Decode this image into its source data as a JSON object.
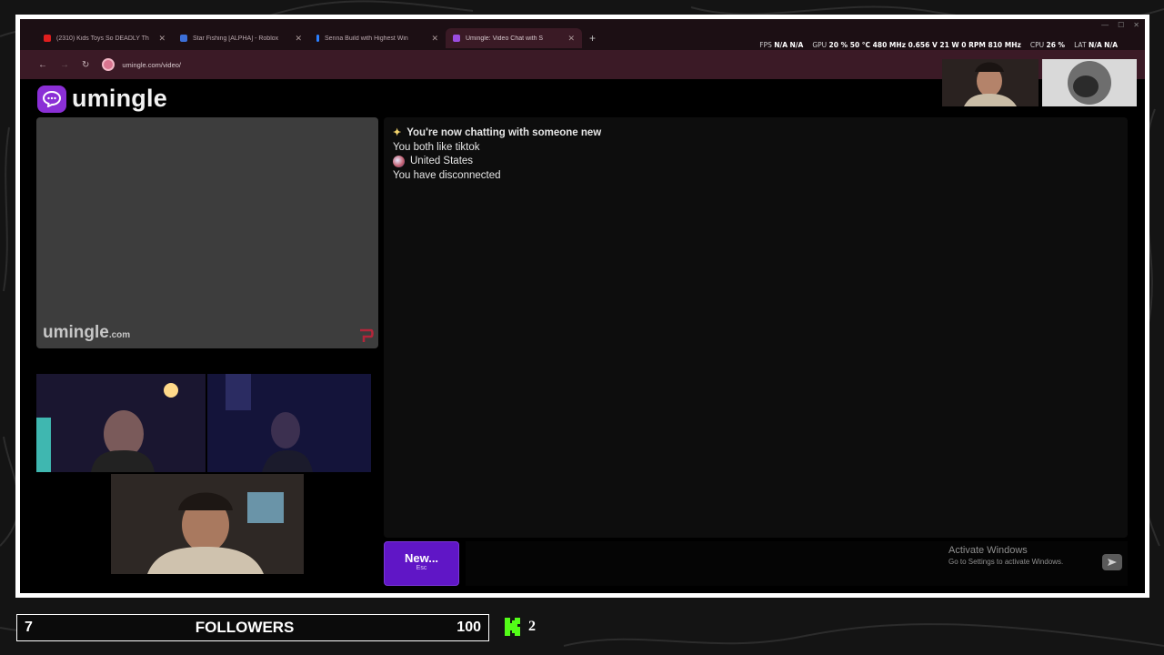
{
  "browser": {
    "tabs": [
      {
        "title": "(2310) Kids Toys So DEADLY Th",
        "favicon_color": "#e01e1e",
        "active": false
      },
      {
        "title": "Star Fishing [ALPHA] - Roblox",
        "favicon_color": "#3c6fd8",
        "active": false
      },
      {
        "title": "Senna Build with Highest Win",
        "favicon_color": "#2a7fff",
        "active": false
      },
      {
        "title": "Umingle: Video Chat with S",
        "favicon_color": "#9b4de0",
        "active": true
      }
    ],
    "new_tab": "+",
    "url": "umingle.com/video/"
  },
  "stats": {
    "fps_label": "FPS",
    "fps_1": "N/A",
    "fps_2": "N/A",
    "gpu_label": "GPU",
    "gpu_values": "20 % 50 °C 480 MHz 0.656 V 21 W 0 RPM 810 MHz",
    "cpu_label": "CPU",
    "cpu_value": "26 %",
    "lat_label": "LAT",
    "lat_1": "N/A",
    "lat_2": "N/A"
  },
  "site": {
    "logo_text": "umingle",
    "watermark": "umingle",
    "watermark_suffix": ".com",
    "brand_color": "#8b2fd6"
  },
  "chat": {
    "messages": [
      {
        "icon": "sparkle-icon",
        "text": "You're now chatting with someone new",
        "bold": true
      },
      {
        "icon": "",
        "text": "You both like tiktok",
        "bold": false
      },
      {
        "icon": "flag-icon",
        "text": "United States",
        "bold": false
      },
      {
        "icon": "",
        "text": "You have disconnected",
        "bold": false
      }
    ]
  },
  "controls": {
    "new_label": "New...",
    "new_hint": "Esc"
  },
  "windows_notice": {
    "title": "Activate Windows",
    "subtitle": "Go to Settings to activate Windows."
  },
  "overlay": {
    "goal_current": "7",
    "goal_label": "FOLLOWERS",
    "goal_target": "100",
    "kick_count": "2",
    "kick_color": "#53fc18"
  }
}
